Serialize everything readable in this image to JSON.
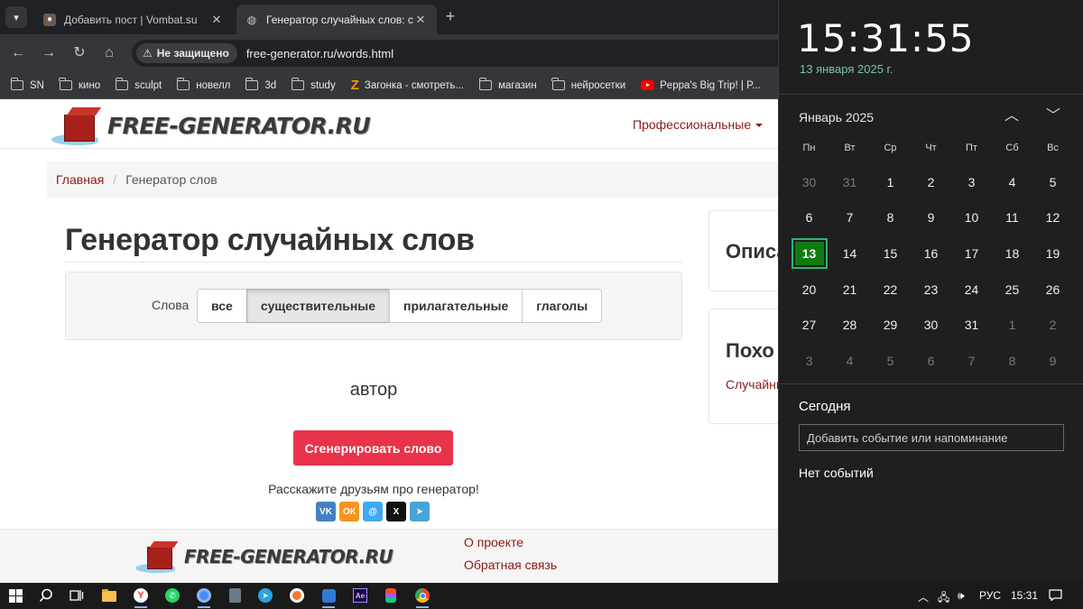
{
  "browser": {
    "tabs": [
      {
        "title": "Добавить пост | Vombat.su",
        "active": false
      },
      {
        "title": "Генератор случайных слов: су",
        "active": true
      }
    ],
    "security_chip": "Не защищено",
    "url": "free-generator.ru/words.html",
    "bookmarks": [
      "SN",
      "кино",
      "sculpt",
      "новелл",
      "3d",
      "study",
      "Загонка - смотреть...",
      "магазин",
      "нейросетки",
      "Peppa's Big Trip! | P..."
    ]
  },
  "site": {
    "logo_text": "FREE-GENERATOR.RU",
    "nav_professional": "Профессиональные",
    "breadcrumb": {
      "home": "Главная",
      "separator": "/",
      "current": "Генератор слов"
    },
    "title": "Генератор случайных слов",
    "filter": {
      "label": "Слова",
      "options": [
        "все",
        "существительные",
        "прилагательные",
        "глаголы"
      ],
      "selected": "существительные"
    },
    "result_word": "автор",
    "generate_button": "Сгенерировать слово",
    "share_text": "Расскажите друзьям про генератор!",
    "share_icons": [
      {
        "name": "vk",
        "label": "VK",
        "color": "#4680c2"
      },
      {
        "name": "odnoklassniki",
        "label": "ОК",
        "color": "#f7931e"
      },
      {
        "name": "moimir",
        "label": "@",
        "color": "#3fa9f5"
      },
      {
        "name": "x",
        "label": "X",
        "color": "#111111"
      },
      {
        "name": "telegram",
        "label": "➤",
        "color": "#4aa3d8"
      }
    ],
    "sidebar": {
      "panel1_title": "Описа",
      "panel2_title": "Похо",
      "panel2_link": "Случайны"
    },
    "footer": {
      "links": [
        "О проекте",
        "Обратная связь"
      ]
    },
    "accent_color": "#8c1a16",
    "button_color": "#e8334a"
  },
  "calendar": {
    "time": "15:31:55",
    "date": "13 января 2025 г.",
    "month_title": "Январь 2025",
    "weekdays": [
      "Пн",
      "Вт",
      "Ср",
      "Чт",
      "Пт",
      "Сб",
      "Вс"
    ],
    "weeks": [
      [
        {
          "d": "30",
          "m": true
        },
        {
          "d": "31",
          "m": true
        },
        {
          "d": "1"
        },
        {
          "d": "2"
        },
        {
          "d": "3"
        },
        {
          "d": "4"
        },
        {
          "d": "5"
        }
      ],
      [
        {
          "d": "6"
        },
        {
          "d": "7"
        },
        {
          "d": "8"
        },
        {
          "d": "9"
        },
        {
          "d": "10"
        },
        {
          "d": "11"
        },
        {
          "d": "12"
        }
      ],
      [
        {
          "d": "13",
          "t": true
        },
        {
          "d": "14"
        },
        {
          "d": "15"
        },
        {
          "d": "16"
        },
        {
          "d": "17"
        },
        {
          "d": "18"
        },
        {
          "d": "19"
        }
      ],
      [
        {
          "d": "20"
        },
        {
          "d": "21"
        },
        {
          "d": "22"
        },
        {
          "d": "23"
        },
        {
          "d": "24"
        },
        {
          "d": "25"
        },
        {
          "d": "26"
        }
      ],
      [
        {
          "d": "27"
        },
        {
          "d": "28"
        },
        {
          "d": "29"
        },
        {
          "d": "30"
        },
        {
          "d": "31"
        },
        {
          "d": "1",
          "m": true
        },
        {
          "d": "2",
          "m": true
        }
      ],
      [
        {
          "d": "3",
          "m": true
        },
        {
          "d": "4",
          "m": true
        },
        {
          "d": "5",
          "m": true
        },
        {
          "d": "6",
          "m": true
        },
        {
          "d": "7",
          "m": true
        },
        {
          "d": "8",
          "m": true
        },
        {
          "d": "9",
          "m": true
        }
      ]
    ],
    "today_heading": "Сегодня",
    "event_placeholder": "Добавить событие или напоминание",
    "no_events": "Нет событий"
  },
  "taskbar": {
    "language": "РУС",
    "time": "15:31",
    "apps": [
      "file-explorer",
      "yandex-browser",
      "whatsapp",
      "chromium",
      "calculator",
      "telegram",
      "blender",
      "app-blue",
      "after-effects",
      "figma",
      "chrome"
    ]
  }
}
